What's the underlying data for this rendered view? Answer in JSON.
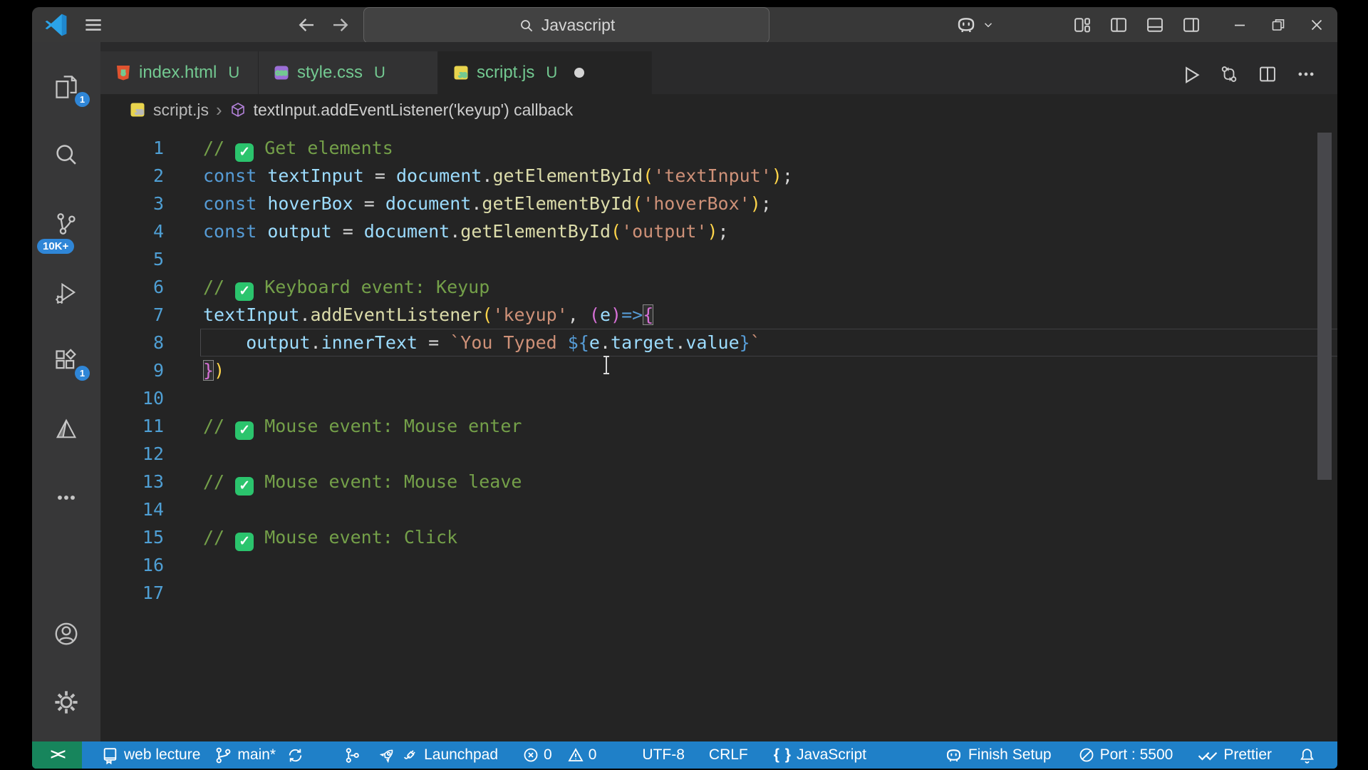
{
  "titlebar": {
    "search_text": "Javascript"
  },
  "tabs": [
    {
      "label": "index.html",
      "git_badge": "U",
      "icon": "html-icon",
      "active": false,
      "dirty": false
    },
    {
      "label": "style.css",
      "git_badge": "U",
      "icon": "css-icon",
      "active": false,
      "dirty": false
    },
    {
      "label": "script.js",
      "git_badge": "U",
      "icon": "js-icon",
      "active": true,
      "dirty": true
    }
  ],
  "breadcrumb": {
    "file": "script.js",
    "file_icon": "js-icon",
    "symbol_icon": "cube-icon",
    "symbol": "textInput.addEventListener('keyup') callback"
  },
  "editor": {
    "current_line": 8,
    "lines": [
      {
        "n": 1,
        "tokens": [
          {
            "s": "cm",
            "t": "// "
          },
          {
            "s": "check"
          },
          {
            "s": "cm",
            "t": " Get elements"
          }
        ]
      },
      {
        "n": 2,
        "tokens": [
          {
            "s": "kw",
            "t": "const"
          },
          {
            "s": "pn",
            "t": " "
          },
          {
            "s": "vr",
            "t": "textInput"
          },
          {
            "s": "pn",
            "t": " = "
          },
          {
            "s": "vr",
            "t": "document"
          },
          {
            "s": "pn",
            "t": "."
          },
          {
            "s": "fn",
            "t": "getElementById"
          },
          {
            "s": "b1",
            "t": "("
          },
          {
            "s": "str",
            "t": "'textInput'"
          },
          {
            "s": "b1",
            "t": ")"
          },
          {
            "s": "pn",
            "t": ";"
          }
        ]
      },
      {
        "n": 3,
        "tokens": [
          {
            "s": "kw",
            "t": "const"
          },
          {
            "s": "pn",
            "t": " "
          },
          {
            "s": "vr",
            "t": "hoverBox"
          },
          {
            "s": "pn",
            "t": " = "
          },
          {
            "s": "vr",
            "t": "document"
          },
          {
            "s": "pn",
            "t": "."
          },
          {
            "s": "fn",
            "t": "getElementById"
          },
          {
            "s": "b1",
            "t": "("
          },
          {
            "s": "str",
            "t": "'hoverBox'"
          },
          {
            "s": "b1",
            "t": ")"
          },
          {
            "s": "pn",
            "t": ";"
          }
        ]
      },
      {
        "n": 4,
        "tokens": [
          {
            "s": "kw",
            "t": "const"
          },
          {
            "s": "pn",
            "t": " "
          },
          {
            "s": "vr",
            "t": "output"
          },
          {
            "s": "pn",
            "t": " = "
          },
          {
            "s": "vr",
            "t": "document"
          },
          {
            "s": "pn",
            "t": "."
          },
          {
            "s": "fn",
            "t": "getElementById"
          },
          {
            "s": "b1",
            "t": "("
          },
          {
            "s": "str",
            "t": "'output'"
          },
          {
            "s": "b1",
            "t": ")"
          },
          {
            "s": "pn",
            "t": ";"
          }
        ]
      },
      {
        "n": 5,
        "tokens": []
      },
      {
        "n": 6,
        "tokens": [
          {
            "s": "cm",
            "t": "// "
          },
          {
            "s": "check"
          },
          {
            "s": "cm",
            "t": " Keyboard event: Keyup"
          }
        ]
      },
      {
        "n": 7,
        "tokens": [
          {
            "s": "vr",
            "t": "textInput"
          },
          {
            "s": "pn",
            "t": "."
          },
          {
            "s": "fn",
            "t": "addEventListener"
          },
          {
            "s": "b1",
            "t": "("
          },
          {
            "s": "str",
            "t": "'keyup'"
          },
          {
            "s": "pn",
            "t": ", "
          },
          {
            "s": "b2",
            "t": "("
          },
          {
            "s": "vr",
            "t": "e"
          },
          {
            "s": "b2",
            "t": ")"
          },
          {
            "s": "arrow",
            "t": "=>"
          },
          {
            "s": "b2m",
            "t": "{"
          }
        ]
      },
      {
        "n": 8,
        "tokens": [
          {
            "s": "pn",
            "t": "    "
          },
          {
            "s": "vr",
            "t": "output"
          },
          {
            "s": "pn",
            "t": "."
          },
          {
            "s": "vr",
            "t": "innerText"
          },
          {
            "s": "pn",
            "t": " = "
          },
          {
            "s": "str",
            "t": "`You Typed "
          },
          {
            "s": "tpl",
            "t": "${"
          },
          {
            "s": "vr",
            "t": "e"
          },
          {
            "s": "pn",
            "t": "."
          },
          {
            "s": "vr",
            "t": "target"
          },
          {
            "s": "pn",
            "t": "."
          },
          {
            "s": "vr",
            "t": "value"
          },
          {
            "s": "tpl",
            "t": "}"
          },
          {
            "s": "str",
            "t": "`"
          }
        ]
      },
      {
        "n": 9,
        "tokens": [
          {
            "s": "b2m",
            "t": "}"
          },
          {
            "s": "b1",
            "t": ")"
          }
        ]
      },
      {
        "n": 10,
        "tokens": []
      },
      {
        "n": 11,
        "tokens": [
          {
            "s": "cm",
            "t": "// "
          },
          {
            "s": "check"
          },
          {
            "s": "cm",
            "t": " Mouse event: Mouse enter"
          }
        ]
      },
      {
        "n": 12,
        "tokens": []
      },
      {
        "n": 13,
        "tokens": [
          {
            "s": "cm",
            "t": "// "
          },
          {
            "s": "check"
          },
          {
            "s": "cm",
            "t": " Mouse event: Mouse leave"
          }
        ]
      },
      {
        "n": 14,
        "tokens": []
      },
      {
        "n": 15,
        "tokens": [
          {
            "s": "cm",
            "t": "// "
          },
          {
            "s": "check"
          },
          {
            "s": "cm",
            "t": " Mouse event: Click"
          }
        ]
      },
      {
        "n": 16,
        "tokens": []
      },
      {
        "n": 17,
        "tokens": []
      }
    ]
  },
  "activity_bar": {
    "top": [
      {
        "name": "explorer",
        "icon": "files-icon",
        "badge": "1"
      },
      {
        "name": "search",
        "icon": "search-icon"
      },
      {
        "name": "source-control",
        "icon": "scm-icon",
        "badge": "10K+"
      },
      {
        "name": "run-debug",
        "icon": "debug-icon"
      },
      {
        "name": "extensions",
        "icon": "extensions-icon",
        "badge": "1"
      },
      {
        "name": "prism",
        "icon": "prism-icon"
      },
      {
        "name": "more",
        "icon": "more-icon"
      }
    ],
    "bottom": [
      {
        "name": "accounts",
        "icon": "account-icon"
      },
      {
        "name": "settings",
        "icon": "gear-icon"
      }
    ]
  },
  "editor_actions": [
    {
      "name": "run-file",
      "icon": "run-icon"
    },
    {
      "name": "open-changes",
      "icon": "compare-icon"
    },
    {
      "name": "split-editor",
      "icon": "split-icon"
    },
    {
      "name": "more-actions",
      "icon": "ellipsis-icon"
    }
  ],
  "status_bar": {
    "left": [
      {
        "name": "web-lecture",
        "icon": "book-icon",
        "label": "web lecture"
      },
      {
        "name": "branch",
        "icon": "branch-icon",
        "label": "main*"
      },
      {
        "name": "sync",
        "icon": "sync-icon",
        "label": ""
      },
      {
        "name": "graph",
        "icon": "graph-icon",
        "label": ""
      },
      {
        "name": "launchpad",
        "icons": [
          "rocket-icon",
          "plug-icon"
        ],
        "label": "Launchpad"
      },
      {
        "name": "problems",
        "parts": [
          {
            "icon": "error-icon",
            "label": "0"
          },
          {
            "icon": "warning-icon",
            "label": "0"
          }
        ]
      },
      {
        "name": "encoding",
        "label": "UTF-8"
      },
      {
        "name": "eol",
        "label": "CRLF"
      },
      {
        "name": "language",
        "icon": "braces-icon",
        "label": "JavaScript"
      }
    ],
    "right": [
      {
        "name": "finish-setup",
        "icon": "copilot-icon",
        "label": "Finish Setup"
      },
      {
        "name": "port",
        "icon": "port-icon",
        "label": "Port : 5500"
      },
      {
        "name": "prettier",
        "icon": "prettier-icon",
        "label": "Prettier"
      },
      {
        "name": "bell",
        "icon": "bell-icon",
        "label": ""
      }
    ]
  },
  "glyphs": {
    "check": "✓",
    "remote": "><",
    "braces": "{ }",
    "separator": "›",
    "gear": "⚙"
  },
  "colors": {
    "status_bar": "#1F80C8",
    "remote_green": "#17855C",
    "badge_blue": "#2F86D7",
    "git_modified_green": "#73C991",
    "comment_green": "#74A049",
    "check_green": "#2BC46D"
  }
}
